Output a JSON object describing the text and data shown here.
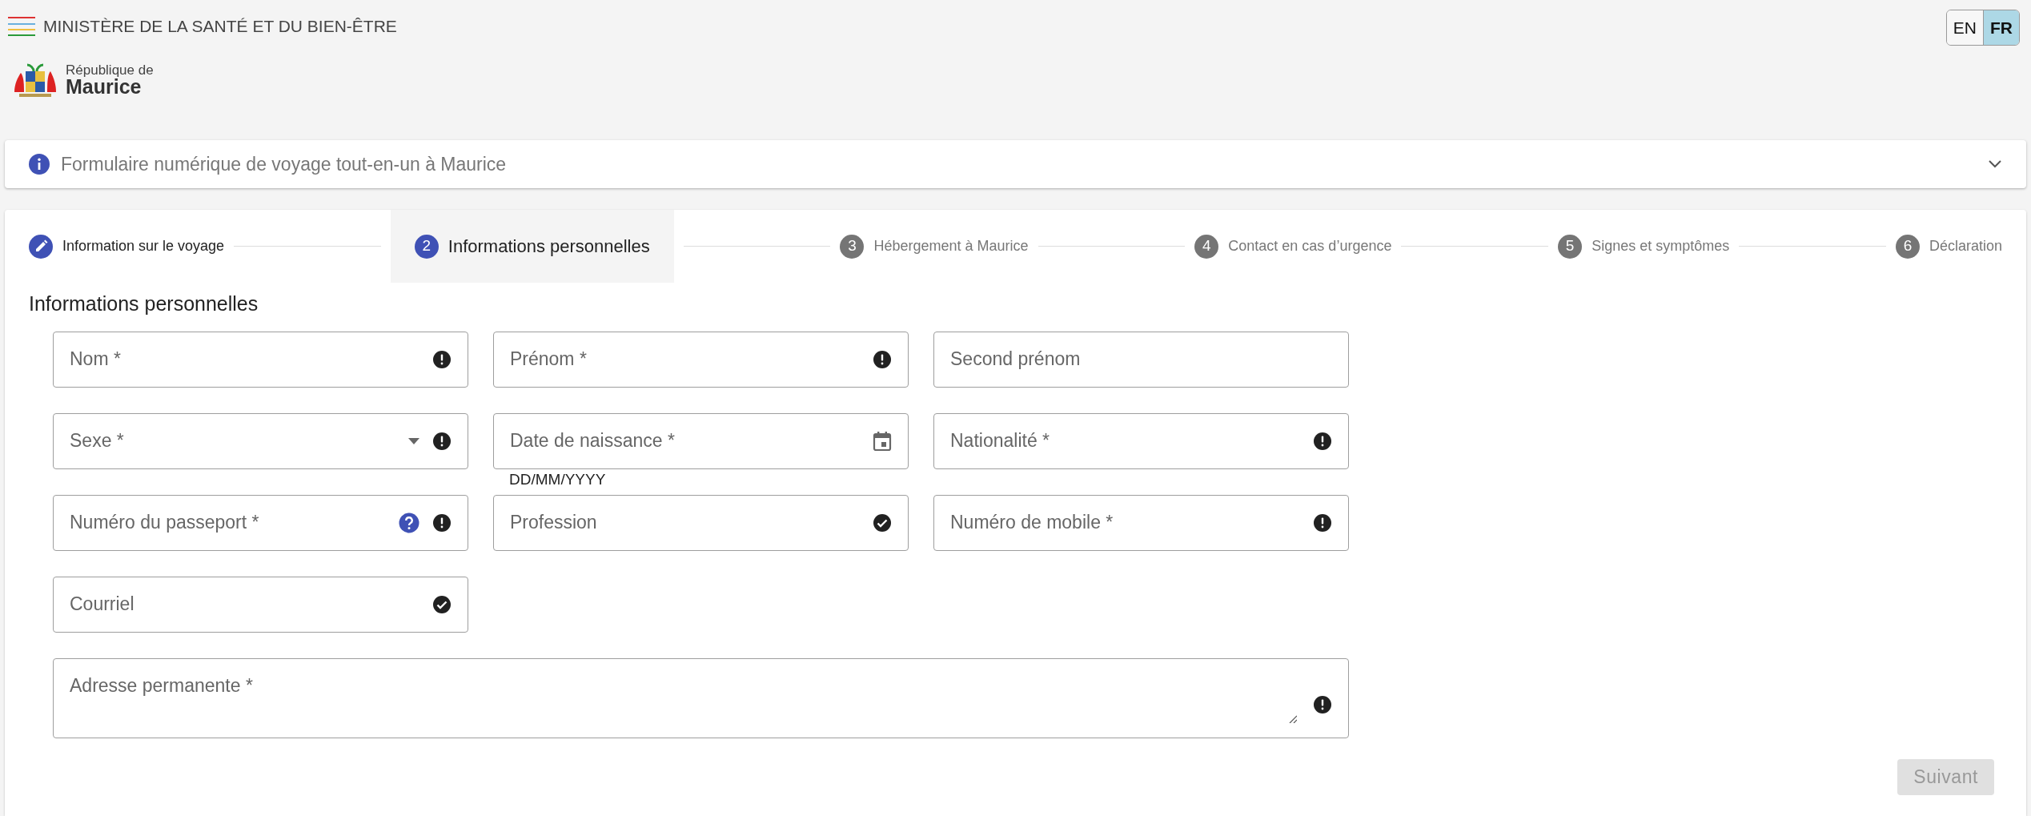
{
  "header": {
    "ministry": "MINISTÈRE DE LA SANTÉ ET DU BIEN-ÊTRE",
    "logo_line_1": "République de",
    "logo_line_2": "Maurice"
  },
  "languages": [
    {
      "label": "EN",
      "selected": false
    },
    {
      "label": "FR",
      "selected": true
    }
  ],
  "accordion": {
    "title": "Formulaire numérique de voyage tout-en-un à Maurice",
    "expanded": false
  },
  "steps": [
    {
      "label": "Information sur le voyage",
      "completed": true,
      "selected": false
    },
    {
      "number": "2",
      "label": "Informations personnelles",
      "completed": false,
      "selected": true
    },
    {
      "number": "3",
      "label": "Hébergement à Maurice",
      "completed": false,
      "selected": false
    },
    {
      "number": "4",
      "label": "Contact en cas d’urgence",
      "completed": false,
      "selected": false
    },
    {
      "number": "5",
      "label": "Signes et symptômes",
      "completed": false,
      "selected": false
    },
    {
      "number": "6",
      "label": "Déclaration",
      "completed": false,
      "selected": false
    }
  ],
  "section_title": "Informations personnelles",
  "fields": [
    {
      "kind": "text",
      "label": "Nom *",
      "invalid": true,
      "valid": false
    },
    {
      "kind": "text",
      "label": "Prénom *",
      "invalid": true,
      "valid": false
    },
    {
      "kind": "text",
      "label": "Second prénom",
      "invalid": false,
      "valid": false
    },
    {
      "kind": "select",
      "label": "Sexe *",
      "invalid": true,
      "valid": false
    },
    {
      "kind": "date",
      "label": "Date de naissance *",
      "invalid": false,
      "valid": false,
      "helper": "DD/MM/YYYY"
    },
    {
      "kind": "text",
      "label": "Nationalité *",
      "invalid": true,
      "valid": false
    },
    {
      "kind": "text",
      "label": "Numéro du passeport *",
      "invalid": true,
      "valid": false,
      "help": true
    },
    {
      "kind": "text",
      "label": "Profession",
      "invalid": false,
      "valid": true
    },
    {
      "kind": "text",
      "label": "Numéro de mobile *",
      "invalid": true,
      "valid": false
    },
    {
      "kind": "text",
      "label": "Courriel",
      "invalid": false,
      "valid": true
    },
    {
      "kind": "textarea",
      "label": "Adresse permanente *",
      "invalid": true,
      "valid": false
    }
  ],
  "next_button": {
    "label": "Suivant",
    "disabled": true
  }
}
